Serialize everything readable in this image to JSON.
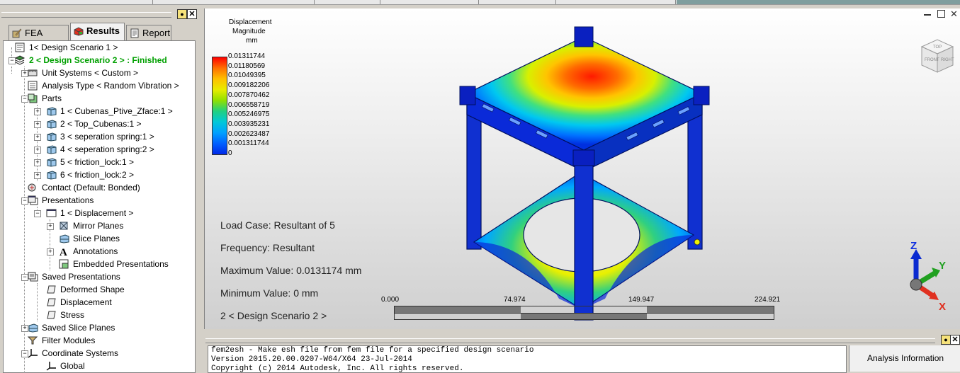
{
  "left_panel": {
    "tabs": [
      {
        "label": "FEA Editor",
        "icon": "fea-editor-icon"
      },
      {
        "label": "Results",
        "icon": "results-icon",
        "active": true
      },
      {
        "label": "Report",
        "icon": "report-icon"
      }
    ],
    "tree": [
      {
        "label": "1< Design Scenario 1 >",
        "icon": "scenario-icon"
      },
      {
        "label": "2 < Design Scenario 2 > : Finished",
        "icon": "stack-icon",
        "highlight": true
      },
      {
        "label": "Unit Systems < Custom >",
        "icon": "units-icon"
      },
      {
        "label": "Analysis Type < Random Vibration >",
        "icon": "analysis-type-icon"
      },
      {
        "label": "Parts",
        "icon": "parts-icon"
      },
      {
        "label": "1 < Cubenas_Ptive_Zface:1 >",
        "icon": "part-icon"
      },
      {
        "label": "2 < Top_Cubenas:1 >",
        "icon": "part-icon"
      },
      {
        "label": "3 < seperation spring:1 >",
        "icon": "part-icon"
      },
      {
        "label": "4 < seperation spring:2 >",
        "icon": "part-icon"
      },
      {
        "label": "5 < friction_lock:1 >",
        "icon": "part-icon"
      },
      {
        "label": "6 < friction_lock:2 >",
        "icon": "part-icon"
      },
      {
        "label": "Contact (Default: Bonded)",
        "icon": "contact-icon"
      },
      {
        "label": "Presentations",
        "icon": "presentations-icon"
      },
      {
        "label": "1 < Displacement >",
        "icon": "presentation-window-icon"
      },
      {
        "label": "Mirror Planes",
        "icon": "mirror-planes-icon"
      },
      {
        "label": "Slice Planes",
        "icon": "slice-planes-icon"
      },
      {
        "label": "Annotations",
        "icon": "annotations-icon"
      },
      {
        "label": "Embedded Presentations",
        "icon": "embedded-presentations-icon"
      },
      {
        "label": "Saved Presentations",
        "icon": "saved-presentations-icon"
      },
      {
        "label": "Deformed Shape",
        "icon": "saved-item-icon"
      },
      {
        "label": "Displacement",
        "icon": "saved-item-icon"
      },
      {
        "label": "Stress",
        "icon": "saved-item-icon"
      },
      {
        "label": "Saved Slice Planes",
        "icon": "saved-slice-planes-icon"
      },
      {
        "label": "Filter Modules",
        "icon": "filter-icon"
      },
      {
        "label": "Coordinate Systems",
        "icon": "coordinate-systems-icon"
      },
      {
        "label": "Global",
        "icon": "global-axis-icon"
      }
    ]
  },
  "viewport": {
    "legend": {
      "title_lines": [
        "Displacement",
        "Magnitude",
        "mm"
      ],
      "values": [
        "0.01311744",
        "0.01180569",
        "0.01049395",
        "0.009182206",
        "0.007870462",
        "0.006558719",
        "0.005246975",
        "0.003935231",
        "0.002623487",
        "0.001311744",
        "0"
      ],
      "colors": [
        "#ff0000",
        "#ff6a00",
        "#ffb000",
        "#e8e800",
        "#9be000",
        "#30d060",
        "#00c8c0",
        "#00a8ff",
        "#0070ff",
        "#0030f0"
      ]
    },
    "info": {
      "load_case": "Load Case:  Resultant of 5",
      "frequency": "Frequency: Resultant",
      "max_value": "Maximum Value: 0.0131174 mm",
      "min_value": "Minimum Value: 0 mm",
      "scenario": "2 < Design Scenario 2 >"
    },
    "scale_bar": {
      "labels": [
        "0.000",
        "74.974",
        "149.947",
        "224.921"
      ]
    },
    "triad": {
      "x": "X",
      "y": "Y",
      "z": "Z"
    },
    "view_cube_faces": [
      "TOP",
      "FRONT",
      "RIGHT"
    ]
  },
  "console": {
    "lines": [
      "fem2esh - Make esh file from fem file for a specified design scenario",
      "Version 2015.20.00.0207-W64/X64 23-Jul-2014",
      "Copyright (c) 2014 Autodesk, Inc. All rights reserved."
    ]
  },
  "analysis_info": {
    "label": "Analysis Information"
  }
}
